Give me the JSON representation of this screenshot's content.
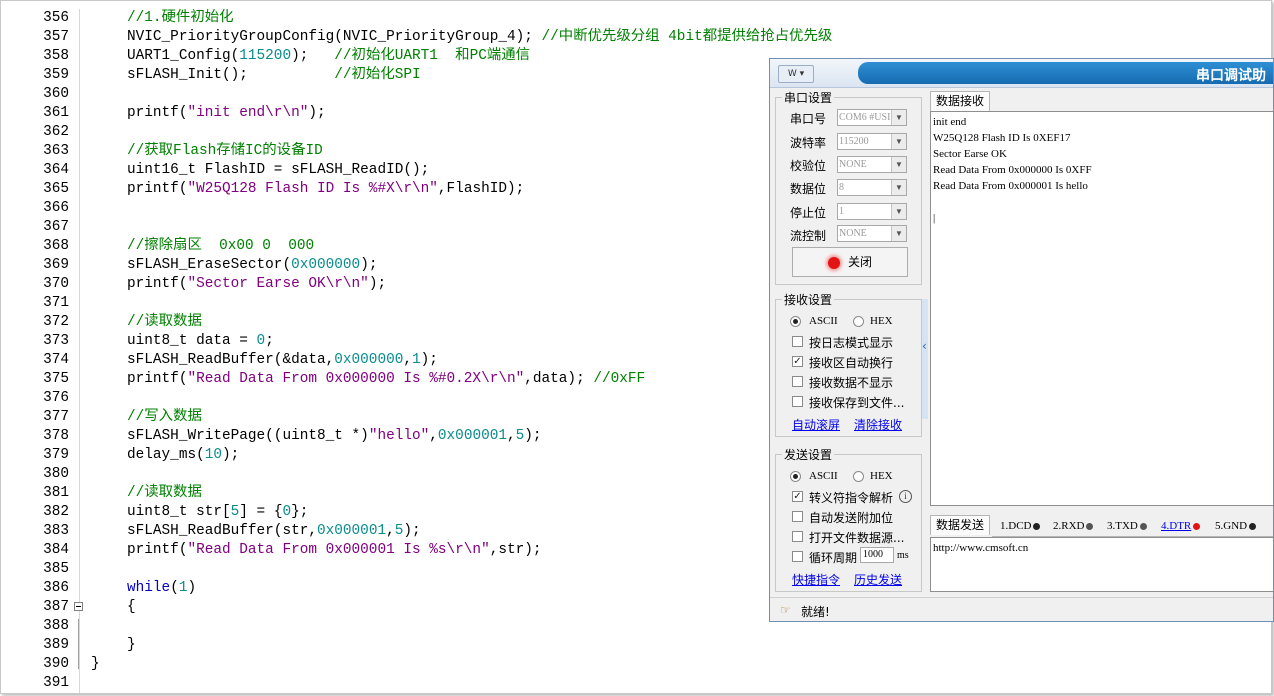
{
  "editor": {
    "lines": [
      {
        "n": "356",
        "html": "<span class=\"cm\">//1.硬件初始化</span>"
      },
      {
        "n": "357",
        "html": "NVIC_PriorityGroupConfig(NVIC_PriorityGroup_4); <span style=\"color:#008000\">//中断优先级分组 4bit都提供给抢占优先级</span>"
      },
      {
        "n": "358",
        "html": "UART1_Config(<span class=\"c-num\">115200</span>);   <span style=\"color:#008000\">//初始化UART1  和PC端通信</span>"
      },
      {
        "n": "359",
        "html": "sFLASH_Init();          <span style=\"color:#008000\">//初始化SPI</span>"
      },
      {
        "n": "360",
        "html": ""
      },
      {
        "n": "361",
        "html": "printf(<span class=\"c-str\">\"init end\\r\\n\"</span>);"
      },
      {
        "n": "362",
        "html": ""
      },
      {
        "n": "363",
        "html": "<span style=\"color:#008000\">//获取Flash存储IC的设备ID</span>"
      },
      {
        "n": "364",
        "html": "uint16_t FlashID = sFLASH_ReadID();"
      },
      {
        "n": "365",
        "html": "printf(<span class=\"c-str\">\"W25Q128 Flash ID Is %#X\\r\\n\"</span>,FlashID);"
      },
      {
        "n": "366",
        "html": ""
      },
      {
        "n": "367",
        "html": ""
      },
      {
        "n": "368",
        "html": "<span style=\"color:#008000\">//擦除扇区  0x00 0  000</span>"
      },
      {
        "n": "369",
        "html": "sFLASH_EraseSector(<span class=\"c-num\">0x000000</span>);"
      },
      {
        "n": "370",
        "html": "printf(<span class=\"c-str\">\"Sector Earse OK\\r\\n\"</span>);"
      },
      {
        "n": "371",
        "html": ""
      },
      {
        "n": "372",
        "html": "<span style=\"color:#008000\">//读取数据</span>"
      },
      {
        "n": "373",
        "html": "uint8_t data = <span class=\"c-num\">0</span>;"
      },
      {
        "n": "374",
        "html": "sFLASH_ReadBuffer(&amp;data,<span class=\"c-num\">0x000000</span>,<span class=\"c-num\">1</span>);"
      },
      {
        "n": "375",
        "html": "printf(<span class=\"c-str\">\"Read Data From 0x000000 Is %#0.2X\\r\\n\"</span>,data); <span style=\"color:#008000\">//0xFF</span>"
      },
      {
        "n": "376",
        "html": ""
      },
      {
        "n": "377",
        "html": "<span style=\"color:#008000\">//写入数据</span>"
      },
      {
        "n": "378",
        "html": "sFLASH_WritePage((uint8_t *)<span class=\"c-str\">\"hello\"</span>,<span class=\"c-num\">0x000001</span>,<span class=\"c-num\">5</span>);"
      },
      {
        "n": "379",
        "html": "delay_ms(<span class=\"c-num\">10</span>);"
      },
      {
        "n": "380",
        "html": ""
      },
      {
        "n": "381",
        "html": "<span style=\"color:#008000\">//读取数据</span>"
      },
      {
        "n": "382",
        "html": "uint8_t str[<span class=\"c-num\">5</span>] = {<span class=\"c-num\">0</span>};"
      },
      {
        "n": "383",
        "html": "sFLASH_ReadBuffer(str,<span class=\"c-num\">0x000001</span>,<span class=\"c-num\">5</span>);"
      },
      {
        "n": "384",
        "html": "printf(<span class=\"c-str\">\"Read Data From 0x000001 Is %s\\r\\n\"</span>,str);"
      },
      {
        "n": "385",
        "html": ""
      },
      {
        "n": "386",
        "html": "<span class=\"c-kw\">while</span>(<span class=\"c-num\">1</span>)"
      },
      {
        "n": "387",
        "html": "{"
      },
      {
        "n": "388",
        "html": ""
      },
      {
        "n": "389",
        "html": "}"
      },
      {
        "n": "390",
        "html": "}"
      },
      {
        "n": "391",
        "html": ""
      }
    ]
  },
  "serial": {
    "title": "串口调试助",
    "sys_menu": "W ▾",
    "port_group": "串口设置",
    "port_label": "串口号",
    "port_value": "COM6 #USI",
    "baud_label": "波特率",
    "baud_value": "115200",
    "parity_label": "校验位",
    "parity_value": "NONE",
    "databits_label": "数据位",
    "databits_value": "8",
    "stopbits_label": "停止位",
    "stopbits_value": "1",
    "flow_label": "流控制",
    "flow_value": "NONE",
    "close_button": "关闭",
    "recv_group": "接收设置",
    "recv_ascii": "ASCII",
    "recv_hex": "HEX",
    "recv_log_mode": "按日志模式显示",
    "recv_autowrap": "接收区自动换行",
    "recv_nodisplay": "接收数据不显示",
    "recv_savefile": "接收保存到文件...",
    "auto_scroll": "自动滚屏",
    "clear_recv": "清除接收",
    "send_group": "发送设置",
    "send_ascii": "ASCII",
    "send_hex": "HEX",
    "escape_parse": "转义符指令解析",
    "auto_append": "自动发送附加位",
    "open_file_source": "打开文件数据源...",
    "cycle_label": "循环周期",
    "cycle_value": "1000",
    "cycle_unit": "ms",
    "quick_cmd": "快捷指令",
    "history_send": "历史发送",
    "recv_tab": "数据接收",
    "recv_text": "init end\nW25Q128 Flash ID Is 0XEF17\nSector Earse OK\nRead Data From 0x000000 Is 0XFF\nRead Data From 0x000001 Is hello\n\n|",
    "send_tab": "数据发送",
    "sig_dcd": "1.DCD",
    "sig_rxd": "2.RXD",
    "sig_txd": "3.TXD",
    "sig_dtr": "4.DTR",
    "sig_gnd": "5.GND",
    "send_text": "http://www.cmsoft.cn",
    "status_text": "就绪!"
  },
  "colors": {
    "comment": "#008000",
    "number": "#0a8c8c",
    "string": "#800080",
    "keyword": "#0000c8",
    "title_banner": "#1d78be"
  }
}
